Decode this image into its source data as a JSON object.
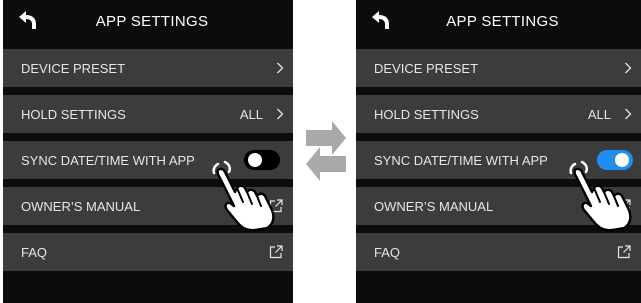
{
  "colors": {
    "screen_bg": "#0c0c0c",
    "row_bg": "#3c3c3c",
    "text": "#e6e6e6",
    "toggle_on": "#1e8ef0",
    "toggle_off": "#000000",
    "arrows": "#a9a9a9"
  },
  "screens": [
    {
      "state": "before",
      "header": {
        "title": "APP SETTINGS",
        "back_icon": "back-arrow-icon"
      },
      "rows": [
        {
          "label": "DEVICE PRESET",
          "icon": "chevron-right-icon"
        },
        {
          "label": "HOLD SETTINGS",
          "value": "ALL",
          "icon": "chevron-right-icon"
        },
        {
          "label": "SYNC DATE/TIME WITH APP",
          "toggle": "off"
        },
        {
          "label": "OWNER’S MANUAL",
          "icon": "external-link-icon"
        },
        {
          "label": "FAQ",
          "icon": "external-link-icon"
        }
      ],
      "pointer": "tapping-hand-icon"
    },
    {
      "state": "after",
      "header": {
        "title": "APP SETTINGS",
        "back_icon": "back-arrow-icon"
      },
      "rows": [
        {
          "label": "DEVICE PRESET",
          "icon": "chevron-right-icon"
        },
        {
          "label": "HOLD SETTINGS",
          "value": "ALL",
          "icon": "chevron-right-icon"
        },
        {
          "label": "SYNC DATE/TIME WITH APP",
          "toggle": "on"
        },
        {
          "label": "OWNER’S MANUAL",
          "icon": "external-link-icon"
        },
        {
          "label": "FAQ",
          "icon": "external-link-icon"
        }
      ],
      "pointer": "tapping-hand-icon"
    }
  ],
  "transition_icon": "swap-arrows-icon"
}
